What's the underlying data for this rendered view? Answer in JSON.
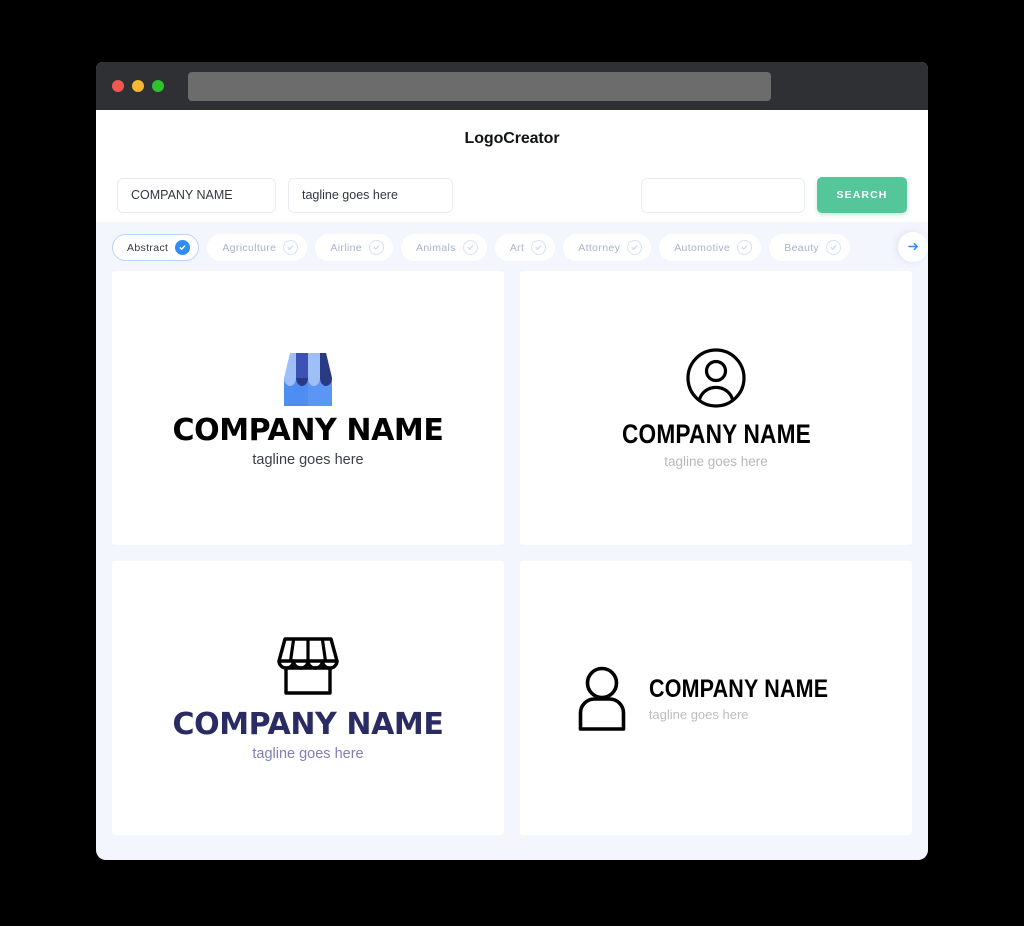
{
  "window": {
    "traffic_lights": [
      "close-red",
      "minimize-yellow",
      "maximize-green"
    ],
    "url_value": ""
  },
  "header": {
    "title": "LogoCreator"
  },
  "search": {
    "company_value": "COMPANY NAME",
    "company_placeholder": "COMPANY NAME",
    "tagline_value": "tagline goes here",
    "tagline_placeholder": "tagline goes here",
    "extra_value": "",
    "extra_placeholder": "",
    "button_label": "SEARCH",
    "button_color": "#55c69a"
  },
  "categories": {
    "next_icon": "arrow-right-icon",
    "accent_color": "#2e8cf5",
    "items": [
      {
        "label": "Abstract",
        "selected": true
      },
      {
        "label": "Agriculture",
        "selected": false
      },
      {
        "label": "Airline",
        "selected": false
      },
      {
        "label": "Animals",
        "selected": false
      },
      {
        "label": "Art",
        "selected": false
      },
      {
        "label": "Attorney",
        "selected": false
      },
      {
        "label": "Automotive",
        "selected": false
      },
      {
        "label": "Beauty",
        "selected": false
      }
    ]
  },
  "results": {
    "cards": [
      {
        "icon": "storefront-awning-filled-icon",
        "name": "COMPANY NAME",
        "tagline": "tagline goes here",
        "name_color": "#000000",
        "tagline_color": "#3b3f45"
      },
      {
        "icon": "person-in-circle-outline-icon",
        "name": "COMPANY NAME",
        "tagline": "tagline goes here",
        "name_color": "#000000",
        "tagline_color": "#b8b8b8"
      },
      {
        "icon": "storefront-awning-outline-icon",
        "name": "COMPANY NAME",
        "tagline": "tagline goes here",
        "name_color": "#2b2b63",
        "tagline_color": "#7f7fb5"
      },
      {
        "icon": "person-outline-icon",
        "name": "COMPANY NAME",
        "tagline": "tagline goes here",
        "name_color": "#000000",
        "tagline_color": "#bdbdbd"
      }
    ]
  }
}
